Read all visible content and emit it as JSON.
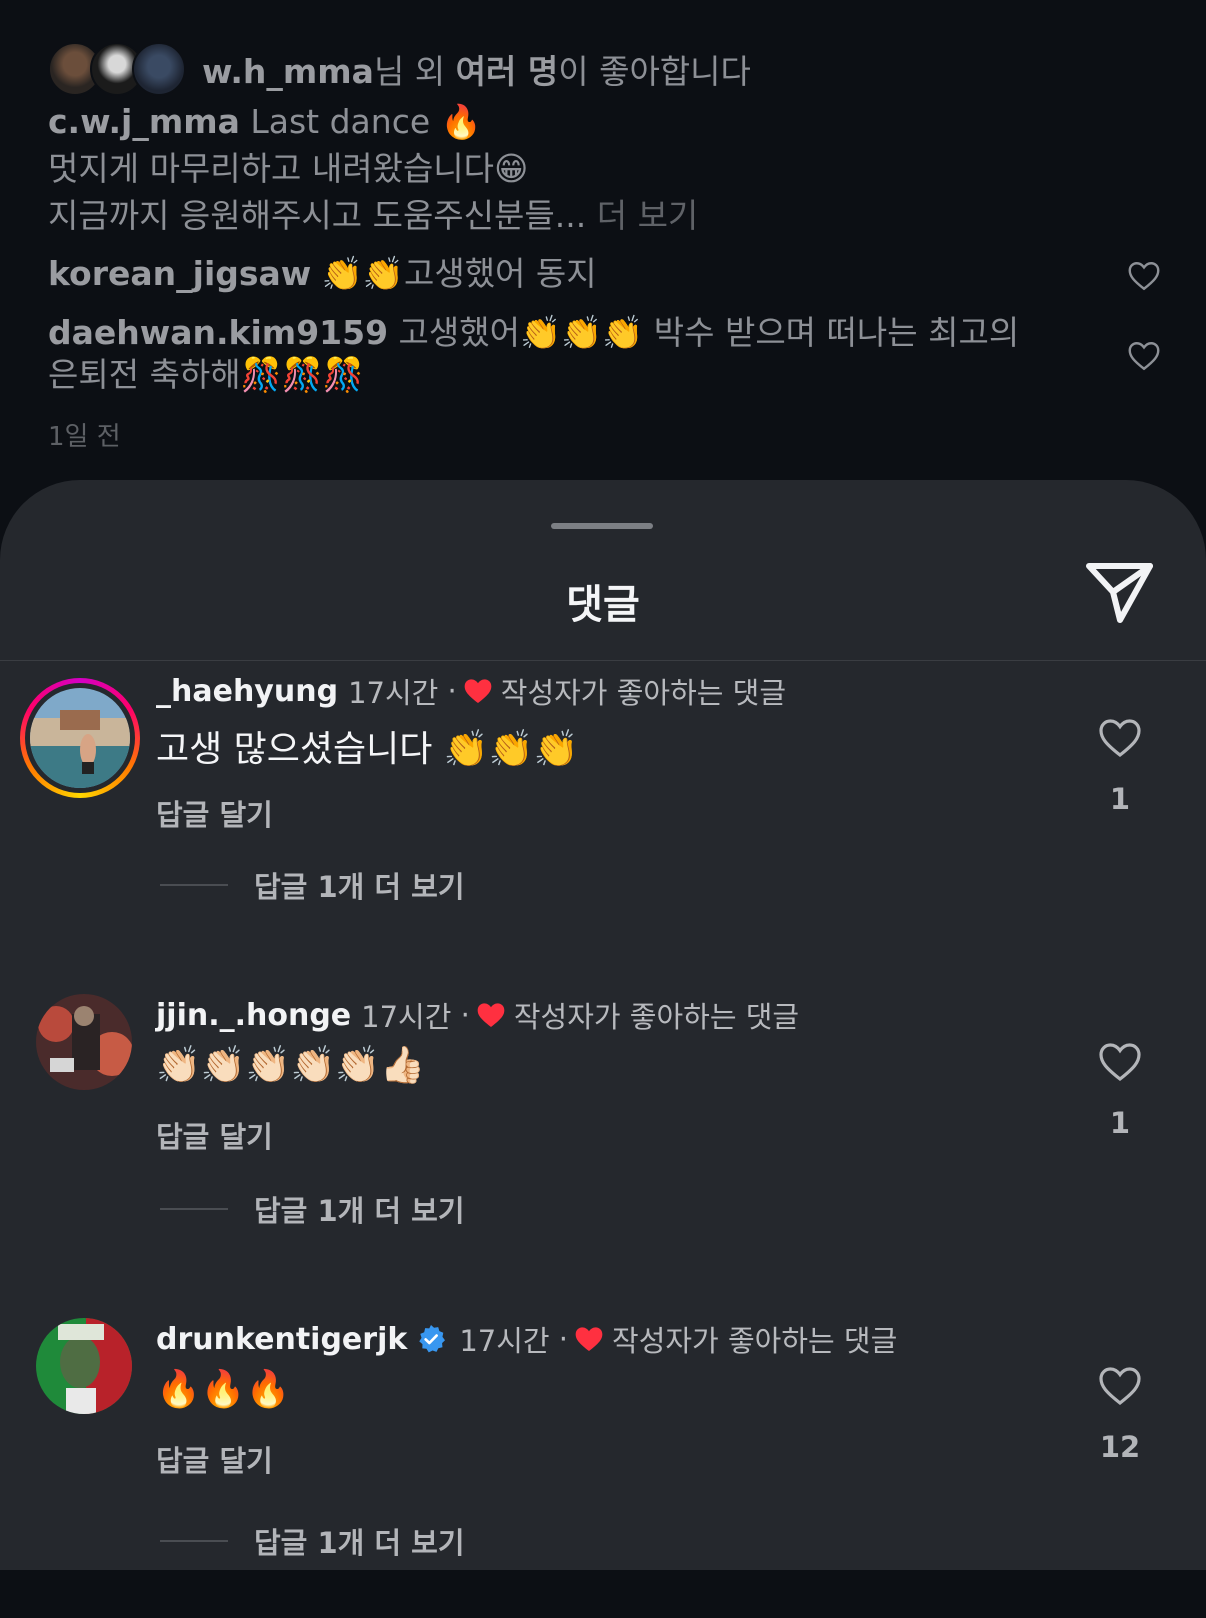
{
  "post": {
    "likes": {
      "user": "w.h_mma",
      "suffix_1": "님 외 ",
      "many": "여러 명",
      "suffix_2": "이 좋아합니다"
    },
    "caption": {
      "user": "c.w.j_mma",
      "line1": "Last dance 🔥",
      "line2": "멋지게 마무리하고 내려왔습니다😁",
      "line3": "지금까지 응원해주시고 도움주신분들...",
      "more": "더 보기"
    },
    "comments": [
      {
        "user": "korean_jigsaw",
        "text": "👏👏고생했어 동지"
      },
      {
        "user": "daehwan.kim9159",
        "text": "고생했어👏👏👏 박수 받으며 떠나는 최고의",
        "text2": "은퇴전 축하해🎊🎊🎊"
      }
    ],
    "time": "1일 전"
  },
  "sheet": {
    "title": "댓글",
    "reply_label": "답글 달기",
    "liked_by_author": "작성자가 좋아하는 댓글",
    "comments": [
      {
        "user": "_haehyung",
        "time": "17시간",
        "sep": "·",
        "text": "고생 많으셨습니다 👏👏👏",
        "likes": "1",
        "view_replies": "답글 1개 더 보기"
      },
      {
        "user": "jjin._.honge",
        "time": "17시간",
        "sep": "·",
        "text": "👏🏻👏🏻👏🏻👏🏻👏🏻👍🏻",
        "likes": "1",
        "view_replies": "답글 1개 더 보기"
      },
      {
        "user": "drunkentigerjk",
        "time": "17시간",
        "sep": "·",
        "text": "🔥🔥🔥",
        "likes": "12",
        "view_replies": "답글 1개 더 보기"
      }
    ]
  },
  "colors": {
    "accent_red": "#ff3040",
    "verified_blue": "#3897f0",
    "sheet_bg": "#25282d"
  }
}
